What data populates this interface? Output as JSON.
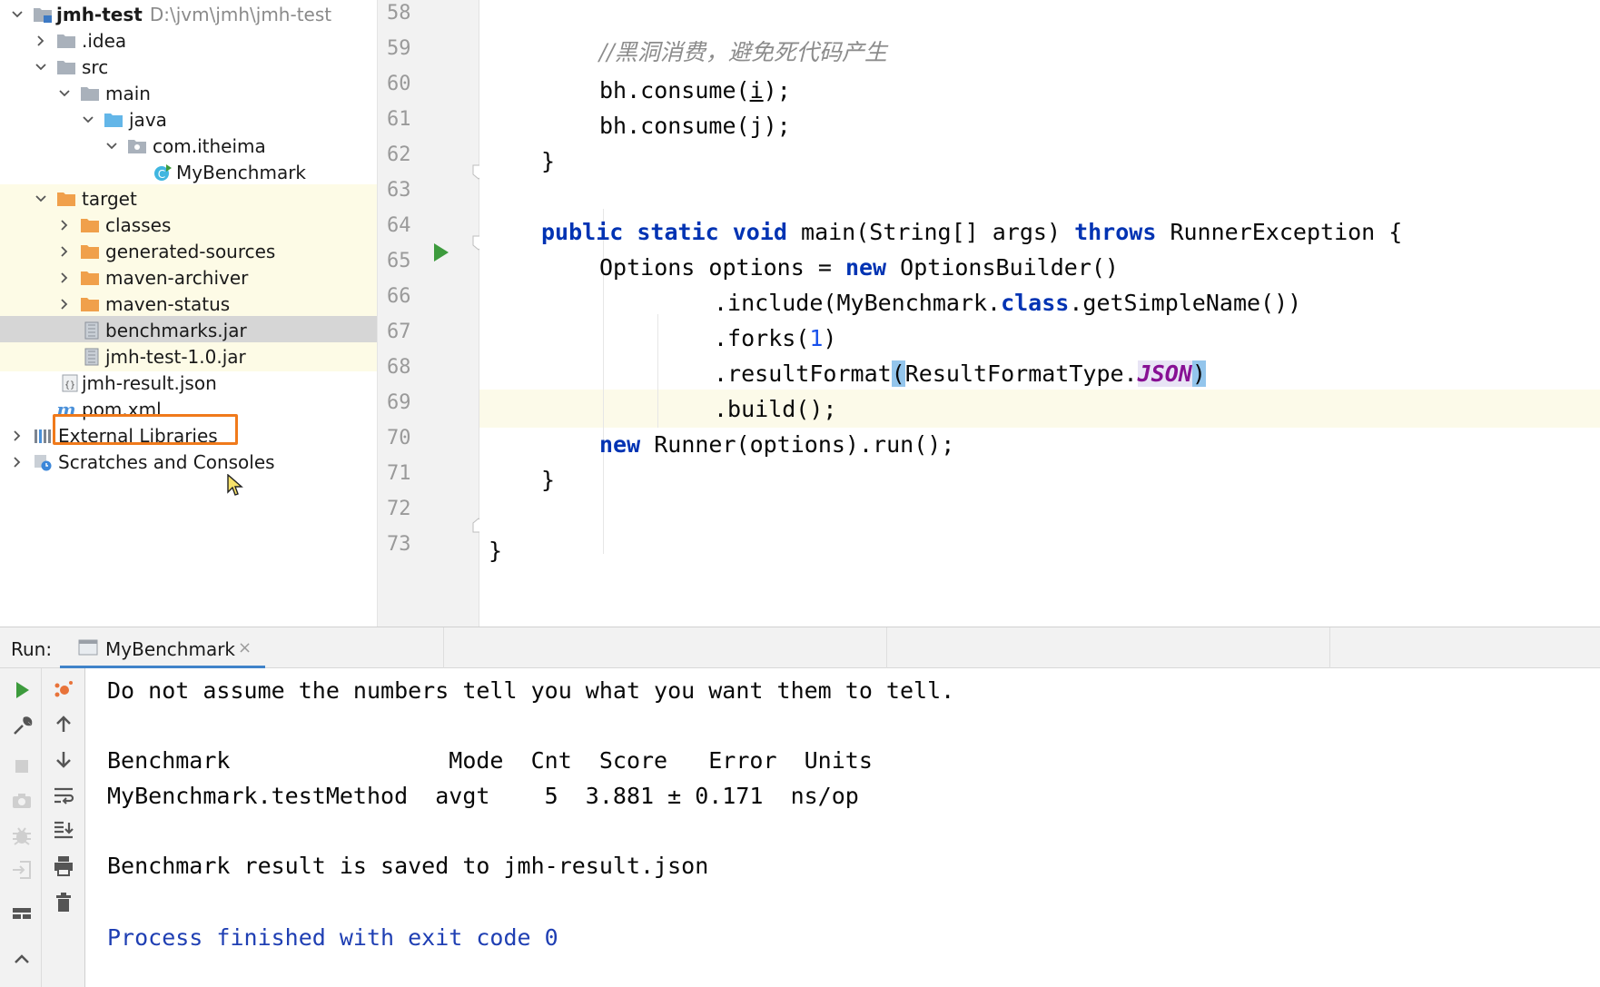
{
  "project_tree": {
    "root": {
      "name": "jmh-test",
      "path": "D:\\jvm\\jmh\\jmh-test"
    },
    "items": [
      {
        "label": ".idea"
      },
      {
        "label": "src"
      },
      {
        "label": "main"
      },
      {
        "label": "java"
      },
      {
        "label": "com.itheima"
      },
      {
        "label": "MyBenchmark"
      },
      {
        "label": "target"
      },
      {
        "label": "classes"
      },
      {
        "label": "generated-sources"
      },
      {
        "label": "maven-archiver"
      },
      {
        "label": "maven-status"
      },
      {
        "label": "benchmarks.jar"
      },
      {
        "label": "jmh-test-1.0.jar"
      },
      {
        "label": "jmh-result.json"
      },
      {
        "label": "pom.xml"
      },
      {
        "label": "External Libraries"
      },
      {
        "label": "Scratches and Consoles"
      }
    ]
  },
  "editor": {
    "line_numbers": [
      "58",
      "59",
      "60",
      "61",
      "62",
      "63",
      "64",
      "65",
      "66",
      "67",
      "68",
      "69",
      "70",
      "71",
      "72",
      "73"
    ],
    "comment": "//黑洞消费，避免死代码产生",
    "line60": {
      "a": "bh.consume(",
      "b": "i",
      "c": ");"
    },
    "line61": "bh.consume(j);",
    "close_brace": "}",
    "line64": {
      "kw1": "public",
      "kw2": "static",
      "kw3": "void",
      "sig": "main(String[] args)",
      "kw4": "throws",
      "tail": "RunnerException {"
    },
    "line65": {
      "a": "Options options =",
      "kw": "new",
      "b": "OptionsBuilder()"
    },
    "line66": {
      "a": ".include(MyBenchmark.",
      "kw": "class",
      "b": ".getSimpleName())"
    },
    "line67": {
      "a": ".forks(",
      "num": "1",
      "b": ")"
    },
    "line68": {
      "a": ".resultFormat",
      "p1": "(",
      "b": "ResultFormatType.",
      "fld": "JSON",
      "p2": ")"
    },
    "line69": ".build();",
    "line70": {
      "kw": "new",
      "b": "Runner(options).run();"
    },
    "line71": "}",
    "line73": "}"
  },
  "run": {
    "label": "Run:",
    "tab": "MyBenchmark",
    "tab_close": "×"
  },
  "console": {
    "lines": [
      "Do not assume the numbers tell you what you want them to tell.",
      "Benchmark                Mode  Cnt  Score   Error  Units",
      "MyBenchmark.testMethod  avgt    5  3.881 ± 0.171  ns/op",
      "Benchmark result is saved to jmh-result.json",
      "Process finished with exit code 0"
    ]
  },
  "colors": {
    "keyword": "#0033b3",
    "number": "#1750eb",
    "field": "#871094",
    "comment": "#8c8c8c",
    "highlight_box": "#f07a1b",
    "run_green": "#3d9b3d",
    "folder_orange": "#f0a04b",
    "folder_blue": "#63b6e8",
    "folder_gray": "#a9b1bb"
  },
  "icons": [
    "chevron-right-icon",
    "chevron-down-icon",
    "folder-icon",
    "module-folder-icon",
    "source-folder-icon",
    "package-icon",
    "class-icon",
    "jar-icon",
    "json-file-icon",
    "maven-icon",
    "libraries-icon",
    "scratches-icon",
    "run-icon",
    "wrench-icon",
    "stop-icon",
    "camera-icon",
    "debug-icon",
    "exit-icon",
    "layout-icon",
    "arrow-up-icon",
    "arrow-down-icon",
    "soft-wrap-icon",
    "scroll-to-end-icon",
    "print-icon",
    "trash-icon",
    "mouse-cursor-icon"
  ]
}
